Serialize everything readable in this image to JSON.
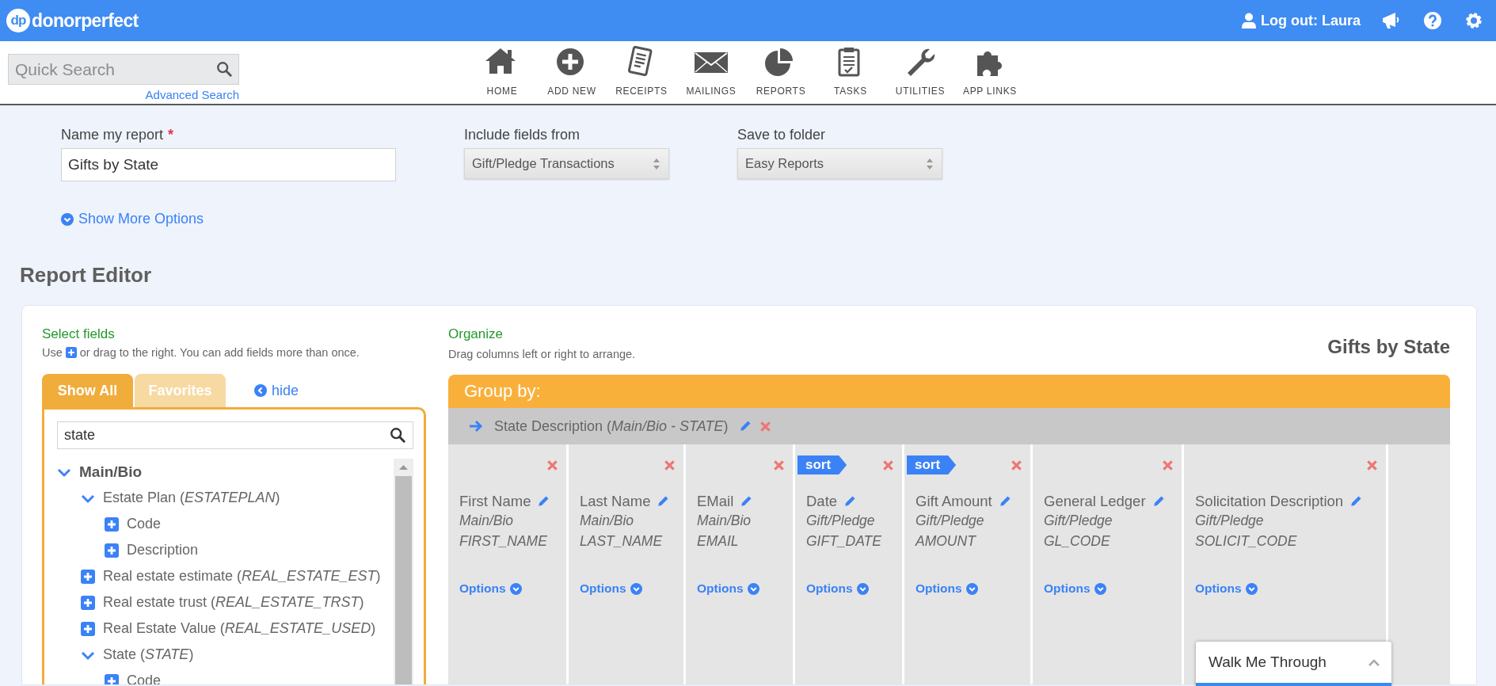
{
  "header": {
    "logo_mark": "dp",
    "logo_name": "donorperfect",
    "logout": "Log out: Laura"
  },
  "toolbar": {
    "quick_search": {
      "placeholder": "Quick Search"
    },
    "advanced_search": "Advanced Search",
    "nav": [
      {
        "label": "HOME"
      },
      {
        "label": "ADD NEW"
      },
      {
        "label": "RECEIPTS"
      },
      {
        "label": "MAILINGS"
      },
      {
        "label": "REPORTS"
      },
      {
        "label": "TASKS"
      },
      {
        "label": "UTILITIES"
      },
      {
        "label": "APP LINKS"
      }
    ]
  },
  "report_form": {
    "name_label": "Name my report",
    "required_mark": "*",
    "name_value": "Gifts by State",
    "include_label": "Include fields from",
    "include_value": "Gift/Pledge Transactions",
    "folder_label": "Save to folder",
    "folder_value": "Easy Reports",
    "more_options": "Show More Options"
  },
  "editor": {
    "title": "Report Editor",
    "select_fields": {
      "heading": "Select fields",
      "hint_before": "Use",
      "hint_after": "or drag to the right. You can add fields more than once.",
      "tabs": [
        {
          "label": "Show All",
          "selected": true
        },
        {
          "label": "Favorites",
          "selected": false
        }
      ],
      "hide": "hide",
      "search": {
        "value": "state"
      },
      "tree": [
        {
          "label": "Main/Bio",
          "kind": "section",
          "expanded": true,
          "children": [
            {
              "label": "Estate Plan (*ESTATEPLAN*)",
              "kind": "group",
              "expanded": true,
              "children": [
                {
                  "label": "Code",
                  "kind": "field"
                },
                {
                  "label": "Description",
                  "kind": "field"
                }
              ]
            },
            {
              "label": "Real estate estimate (*REAL_ESTATE_EST*)",
              "kind": "field"
            },
            {
              "label": "Real estate trust (*REAL_ESTATE_TRST*)",
              "kind": "field"
            },
            {
              "label": "Real Estate Value (*REAL_ESTATE_USED*)",
              "kind": "field"
            },
            {
              "label": "State (*STATE*)",
              "kind": "group",
              "expanded": true,
              "children": [
                {
                  "label": "Code",
                  "kind": "field"
                }
              ]
            }
          ]
        }
      ]
    },
    "organize": {
      "heading": "Organize",
      "hint": "Drag columns left or right to arrange.",
      "report_title": "Gifts by State",
      "group_by": {
        "label": "Group by:",
        "field": "State Description (*Main/Bio - STATE*)"
      },
      "columns": [
        {
          "title": "First Name",
          "source": "Main/Bio",
          "field": "FIRST_NAME",
          "options": "Options"
        },
        {
          "title": "Last Name",
          "source": "Main/Bio",
          "field": "LAST_NAME",
          "options": "Options"
        },
        {
          "title": "EMail",
          "source": "Main/Bio",
          "field": "EMAIL",
          "options": "Options"
        },
        {
          "title": "Date",
          "source": "Gift/Pledge",
          "field": "GIFT_DATE",
          "options": "Options",
          "sort": "sort"
        },
        {
          "title": "Gift Amount",
          "source": "Gift/Pledge",
          "field": "AMOUNT",
          "options": "Options",
          "sort": "sort"
        },
        {
          "title": "General Ledger",
          "source": "Gift/Pledge",
          "field": "GL_CODE",
          "options": "Options"
        },
        {
          "title": "Solicitation Description",
          "source": "Gift/Pledge",
          "field": "SOLICIT_CODE",
          "options": "Options"
        }
      ]
    }
  },
  "walk_me_through": {
    "label": "Walk Me Through"
  }
}
